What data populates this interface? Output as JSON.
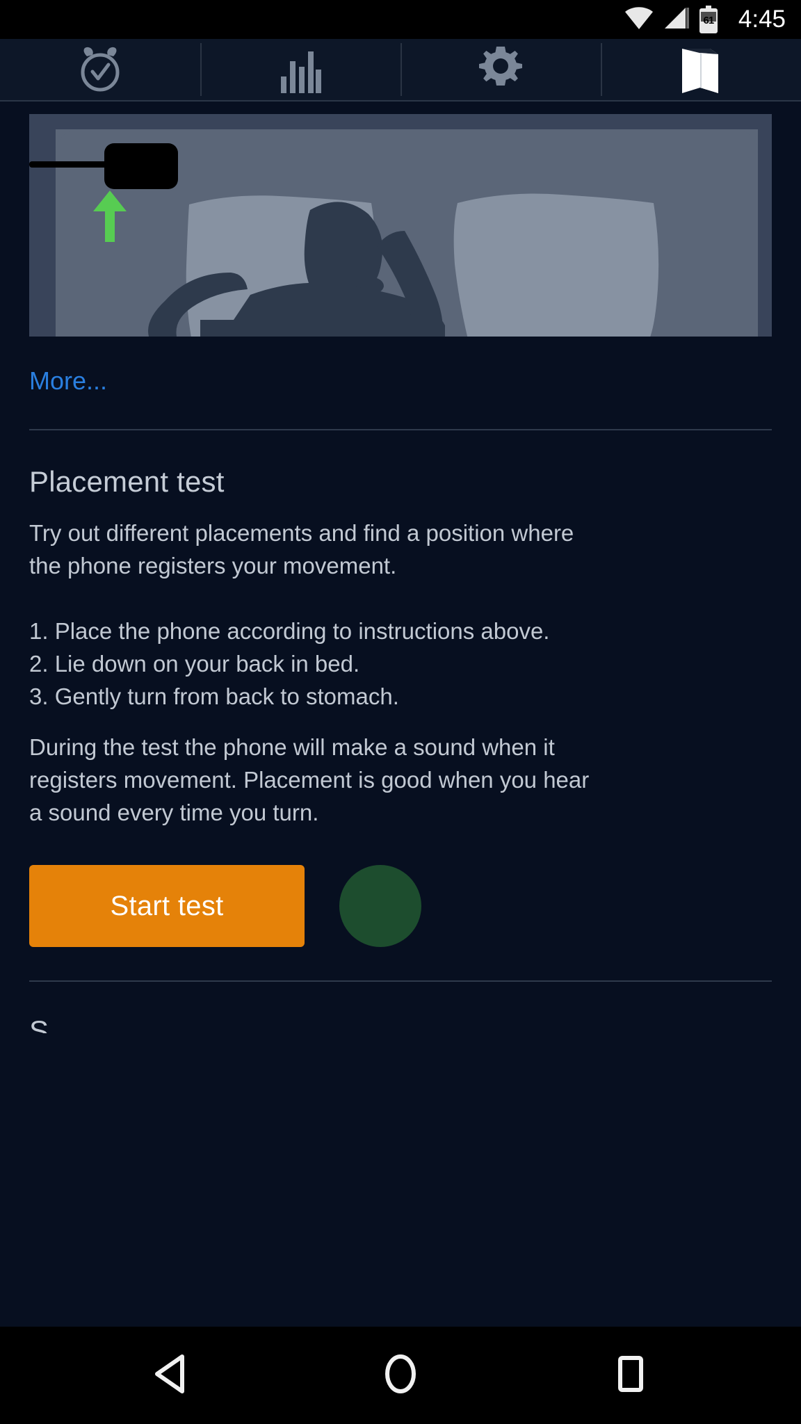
{
  "status_bar": {
    "time": "4:45",
    "battery_level": "61",
    "wifi_icon": "wifi-icon",
    "signal_icon": "cell-signal-icon",
    "battery_icon": "battery-icon"
  },
  "tabs": [
    {
      "id": "alarm",
      "icon": "alarm-clock-icon",
      "active": false
    },
    {
      "id": "stats",
      "icon": "bar-chart-icon",
      "active": false
    },
    {
      "id": "settings",
      "icon": "gear-icon",
      "active": false
    },
    {
      "id": "guide",
      "icon": "book-icon",
      "active": true
    }
  ],
  "illustration": {
    "name": "phone-placement-bed-illustration",
    "alt": "Person lying in bed with phone placed on mattress edge near pillow",
    "arrow_color": "#57cc52",
    "phone_color": "#000000",
    "bed_color": "#5a6678",
    "pillow_color": "#8892a1",
    "person_color": "#2e3a4c"
  },
  "more_link": {
    "label": "More..."
  },
  "main": {
    "title": "Placement test",
    "intro_line_1": "Try out different placements and find a position where",
    "intro_line_2": "the phone registers your movement.",
    "steps": [
      "1. Place the phone according to instructions above.",
      "2. Lie down on your back in bed.",
      "3. Gently turn from back to stomach."
    ],
    "outro_line_1": "During the test the phone will make a sound when it",
    "outro_line_2": "registers movement. Placement is good when you hear",
    "outro_line_3": "a sound every time you turn.",
    "start_button": "Start test",
    "status_indicator": {
      "name": "test-status-indicator",
      "color": "#1d4d2e",
      "state": "inactive"
    },
    "next_section_peek": "S"
  },
  "nav_bar": {
    "back": "back-icon",
    "home": "home-icon",
    "recents": "recents-icon"
  },
  "colors": {
    "background": "#070f20",
    "tabbar_background": "#0d1728",
    "accent_orange": "#e58209",
    "link_blue": "#2a7fe0",
    "text_primary": "#c5ccd6",
    "divider": "#2f3a4c"
  }
}
